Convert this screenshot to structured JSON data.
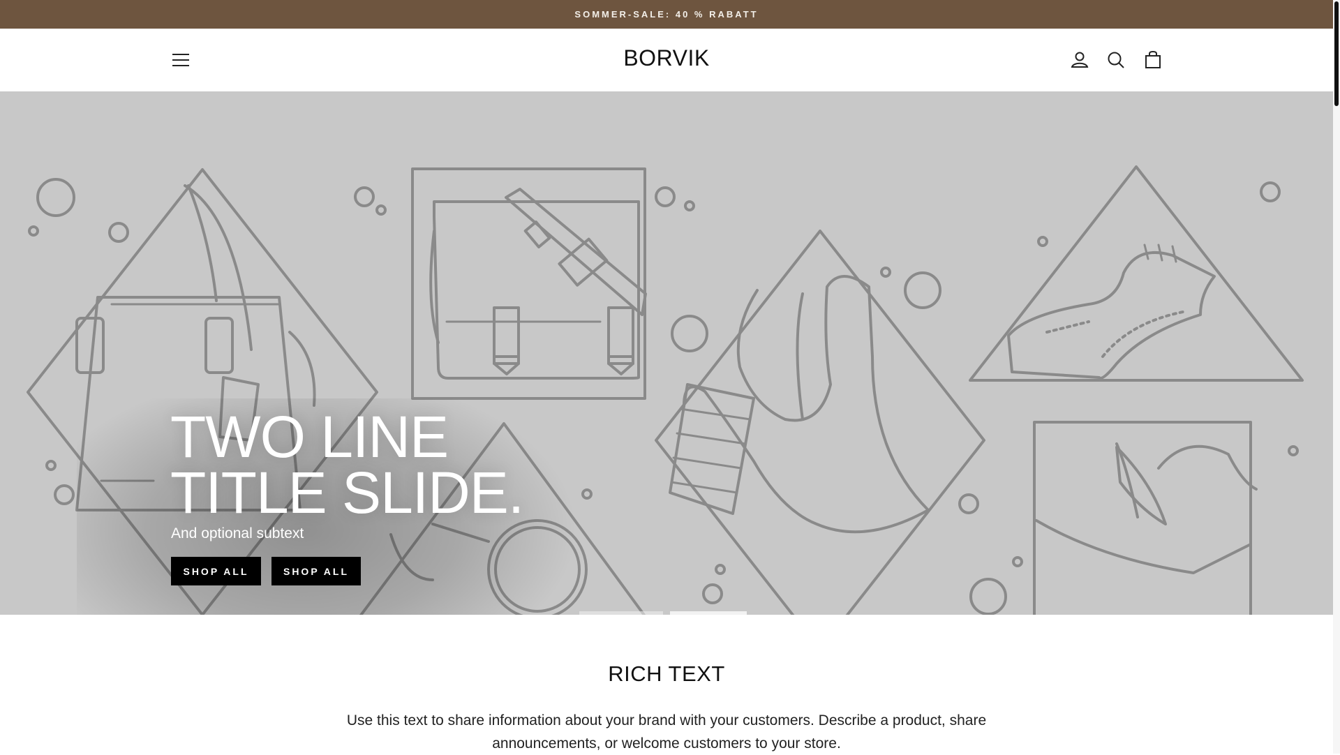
{
  "announcement": {
    "text": "SOMMER-SALE: 40 % RABATT"
  },
  "header": {
    "logo": "BORVIK",
    "icons": [
      "menu-icon",
      "account-icon",
      "search-icon",
      "cart-icon"
    ]
  },
  "hero": {
    "title_line1": "TWO LINE",
    "title_line2": "TITLE SLIDE.",
    "subtitle": "And optional subtext",
    "buttons": [
      {
        "label": "SHOP ALL"
      },
      {
        "label": "SHOP ALL"
      }
    ],
    "slide_count": 2,
    "active_slide": 2
  },
  "rich_text": {
    "title": "RICH TEXT",
    "body": "Use this text to share information about your brand with your customers. Describe a product, share announcements, or welcome customers to your store."
  },
  "colors": {
    "announcement_bg": "#6e553f",
    "hero_bg": "#c8c8c8",
    "line_art": "#8a8a8a",
    "button_bg": "#000000"
  }
}
